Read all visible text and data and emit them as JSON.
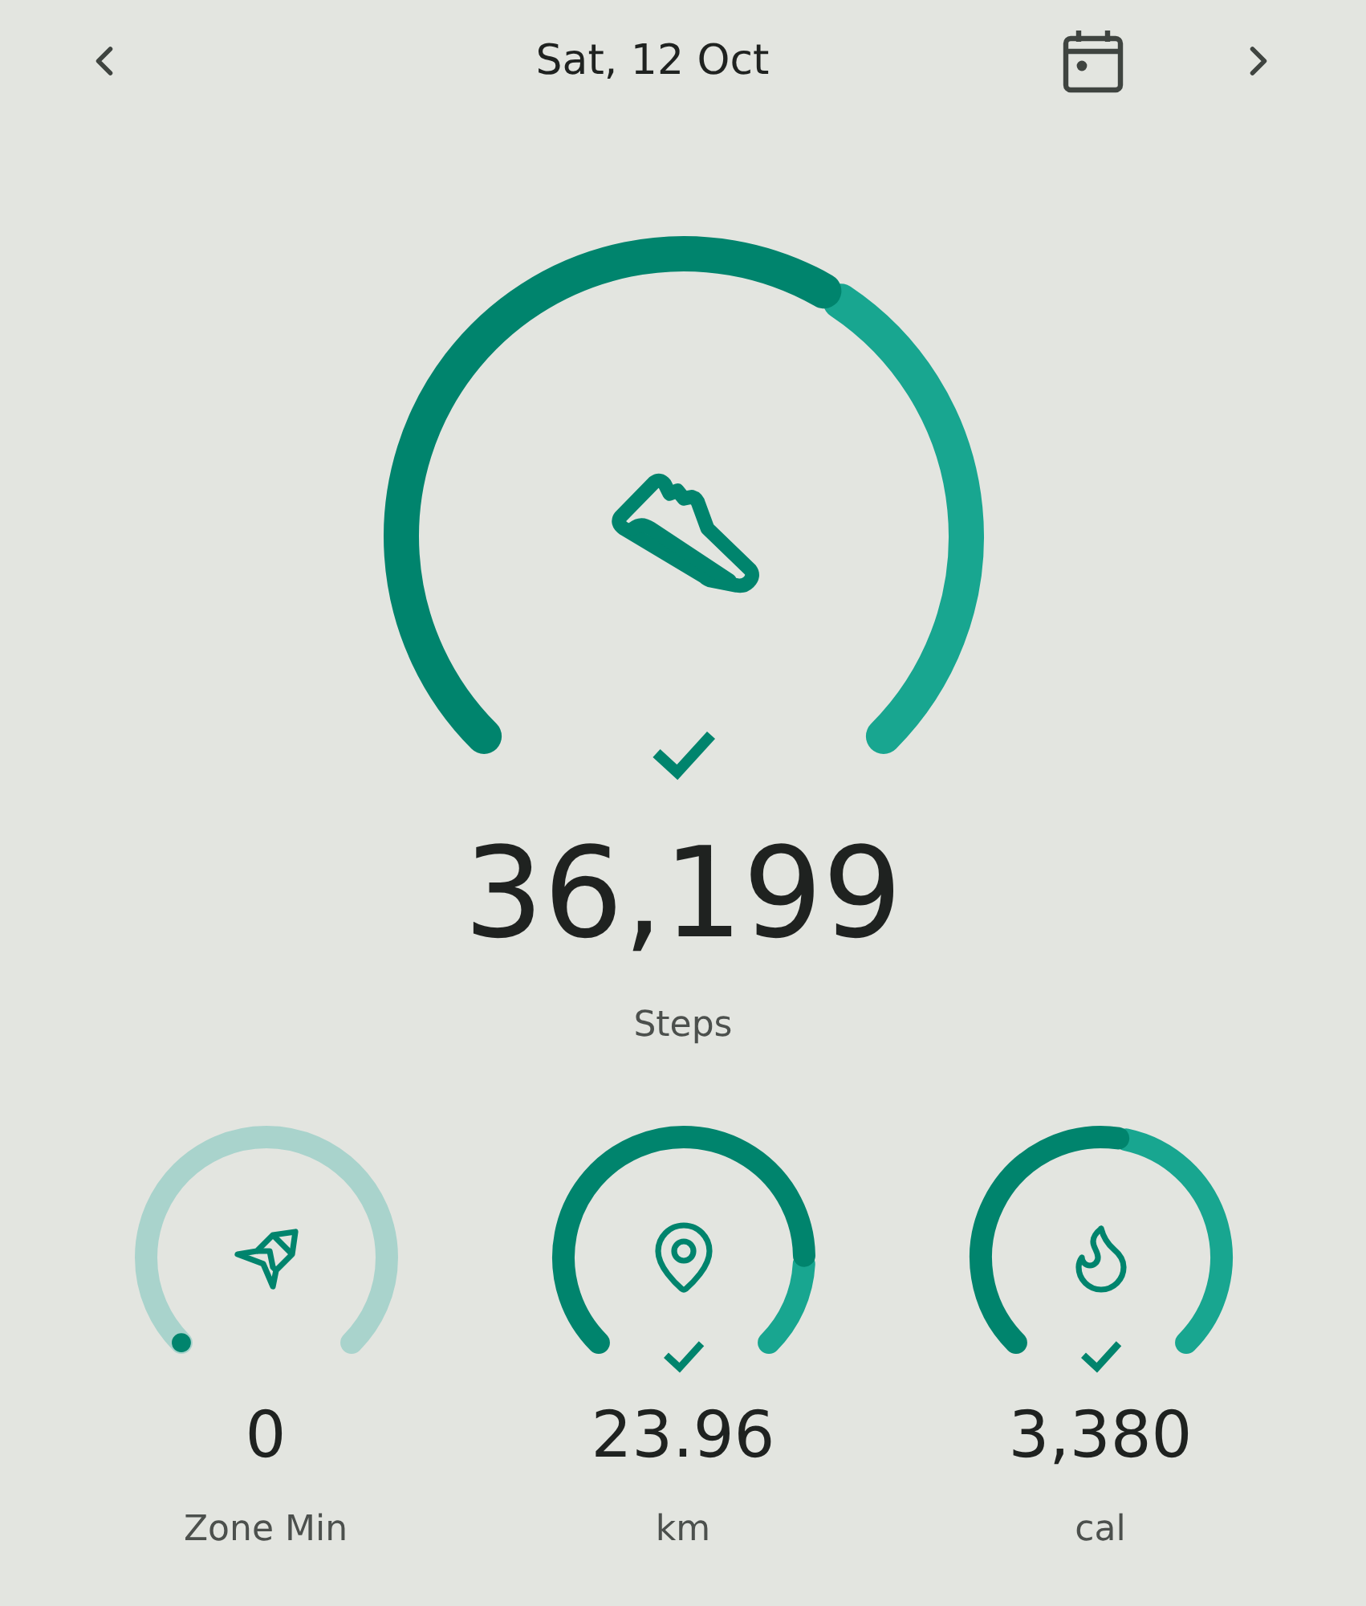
{
  "header": {
    "date": "Sat, 12 Oct"
  },
  "main_metric": {
    "value": "36,199",
    "label": "Steps",
    "goal_met": true
  },
  "metrics": [
    {
      "value": "0",
      "label": "Zone Min",
      "goal_met": false
    },
    {
      "value": "23.96",
      "label": "km",
      "goal_met": true
    },
    {
      "value": "3,380",
      "label": "cal",
      "goal_met": true
    }
  ]
}
